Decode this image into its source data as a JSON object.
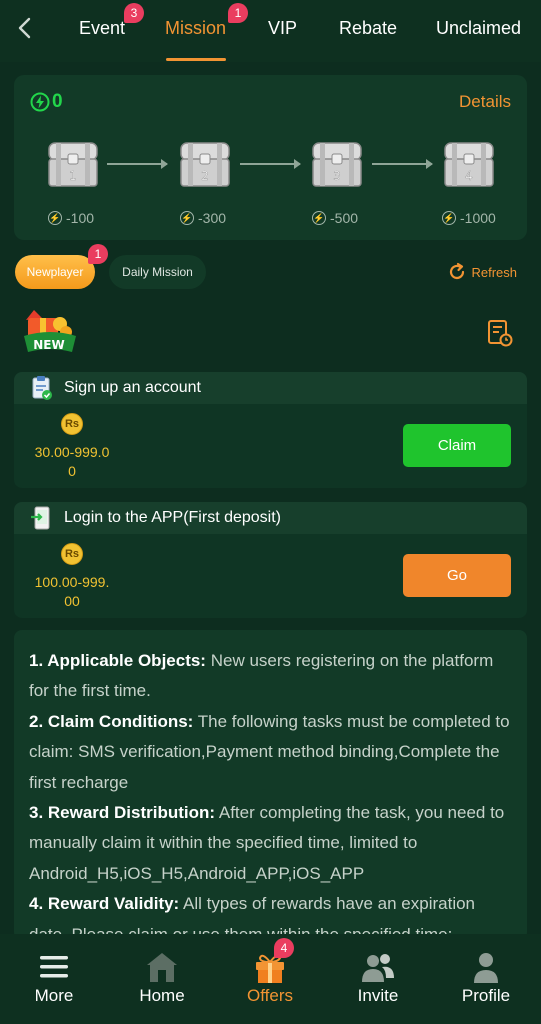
{
  "nav": {
    "tabs": [
      {
        "label": "Event",
        "badge": "3"
      },
      {
        "label": "Mission",
        "badge": "1"
      },
      {
        "label": "VIP"
      },
      {
        "label": "Rebate"
      },
      {
        "label": "Unclaimed"
      }
    ],
    "active_tab": "Mission"
  },
  "chest_panel": {
    "points": "0",
    "details_label": "Details",
    "chests": [
      {
        "number": "1",
        "requirement": "-100"
      },
      {
        "number": "2",
        "requirement": "-300"
      },
      {
        "number": "3",
        "requirement": "-500"
      },
      {
        "number": "4",
        "requirement": "-1000"
      }
    ]
  },
  "filters": {
    "newplayer_label": "Newplayer",
    "newplayer_badge": "1",
    "daily_label": "Daily Mission",
    "refresh_label": "Refresh"
  },
  "new_icon_text": "NEW",
  "tasks": [
    {
      "title": "Sign up an account",
      "currency": "Rs",
      "amount_line1": "30.00-999.0",
      "amount_line2": "0",
      "button": "Claim"
    },
    {
      "title": "Login to the APP(First deposit)",
      "currency": "Rs",
      "amount_line1": "100.00-999.",
      "amount_line2": "00",
      "button": "Go"
    }
  ],
  "rules": [
    {
      "heading": "1. Applicable Objects:",
      "text": " New users registering on the platform for the first time."
    },
    {
      "heading": "2. Claim Conditions:",
      "text": " The following tasks must be completed to claim: SMS verification,Payment method binding,Complete the first recharge"
    },
    {
      "heading": "3. Reward Distribution:",
      "text": " After completing the task, you need to manually claim it within the specified time, limited to Android_H5,iOS_H5,Android_APP,iOS_APP"
    },
    {
      "heading": "4. Reward Validity:",
      "text": " All types of rewards have an expiration date. Please claim or use them within the specified time;"
    }
  ],
  "bottom_nav": [
    {
      "label": "More",
      "icon": "menu-icon"
    },
    {
      "label": "Home",
      "icon": "home-icon"
    },
    {
      "label": "Offers",
      "icon": "gift-icon",
      "badge": "4"
    },
    {
      "label": "Invite",
      "icon": "people-icon"
    },
    {
      "label": "Profile",
      "icon": "profile-icon"
    }
  ],
  "colors": {
    "background": "#0d2d1f",
    "card": "#123a27",
    "accent": "#f29433",
    "claim_green": "#1fc42d",
    "badge_red": "#ea3d5f",
    "coin_gold": "#f1c232"
  }
}
